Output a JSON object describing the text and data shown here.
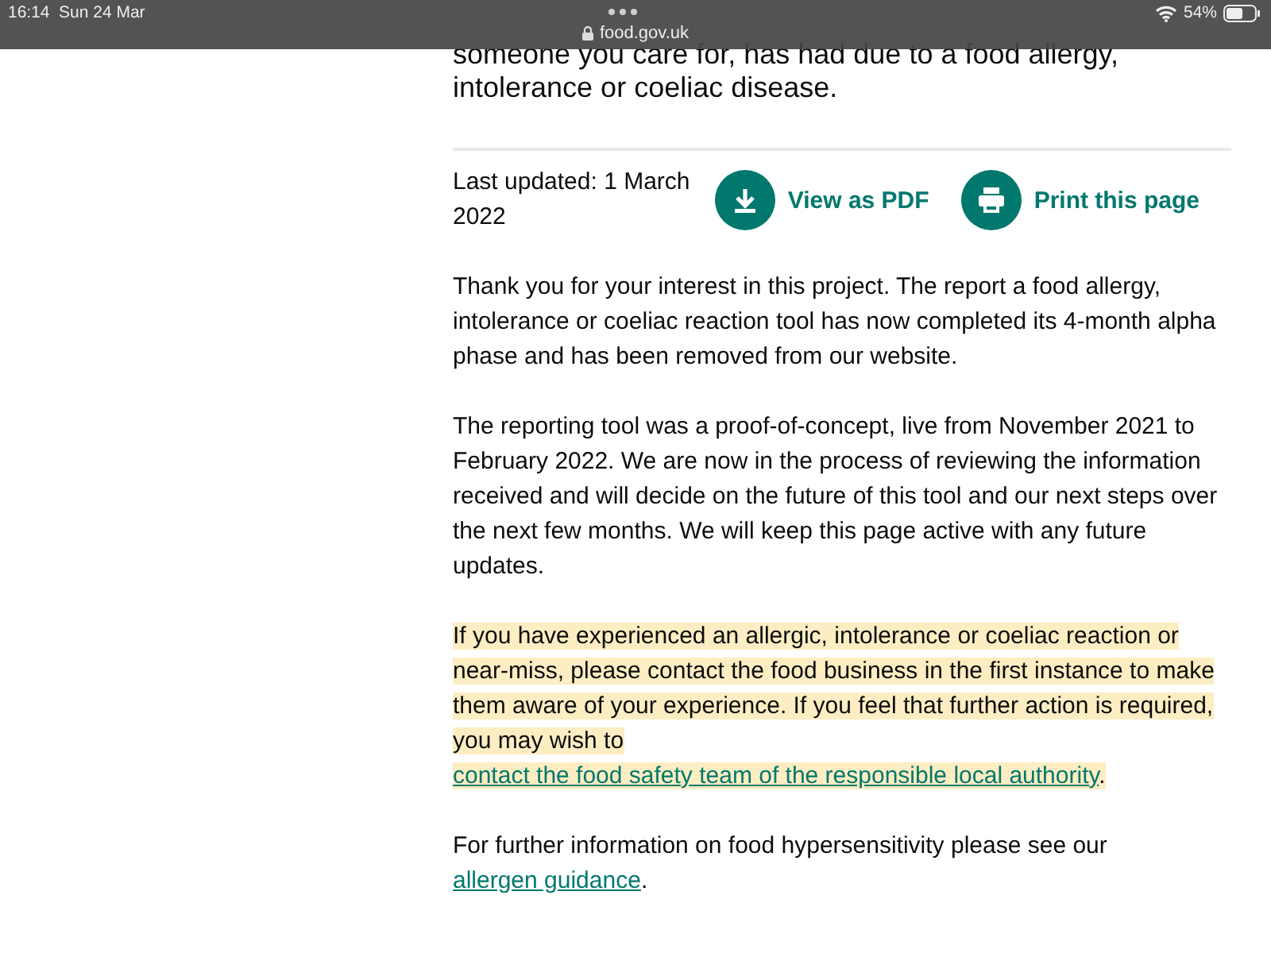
{
  "status_bar": {
    "time": "16:14",
    "date": "Sun 24 Mar",
    "url": "food.gov.uk",
    "battery": "54%"
  },
  "lead": {
    "lines": [
      "someone you care for, has had due to a food allergy,",
      "intolerance or coeliac disease."
    ]
  },
  "meta": {
    "last_updated": "Last updated: 1 March 2022",
    "actions": [
      {
        "kind": "download",
        "label": "View as PDF"
      },
      {
        "kind": "print",
        "label": "Print this page"
      }
    ]
  },
  "paragraphs": [
    {
      "highlighted": false,
      "before": "Thank you for your interest in this project. The report a food allergy, intolerance or coeliac reaction tool has now completed its 4-month alpha phase and has been removed from our website."
    },
    {
      "highlighted": false,
      "before": "The reporting tool was a proof-of-concept, live from November 2021 to February 2022. We are now in the process of reviewing the information received and will decide on the future of this tool and our next steps over the next few months. We will keep this page active with any future updates."
    },
    {
      "highlighted": true,
      "before": "If you have experienced an allergic, intolerance or coeliac reaction or near-miss, please contact the food business in the first instance to make them aware of your experience. If you feel that further action is required, you may wish to ",
      "link": "contact the food safety team of the responsible local authority",
      "after": "."
    },
    {
      "highlighted": false,
      "before": "For further information on food hypersensitivity please see our ",
      "link": "allergen guidance",
      "after": "."
    }
  ]
}
